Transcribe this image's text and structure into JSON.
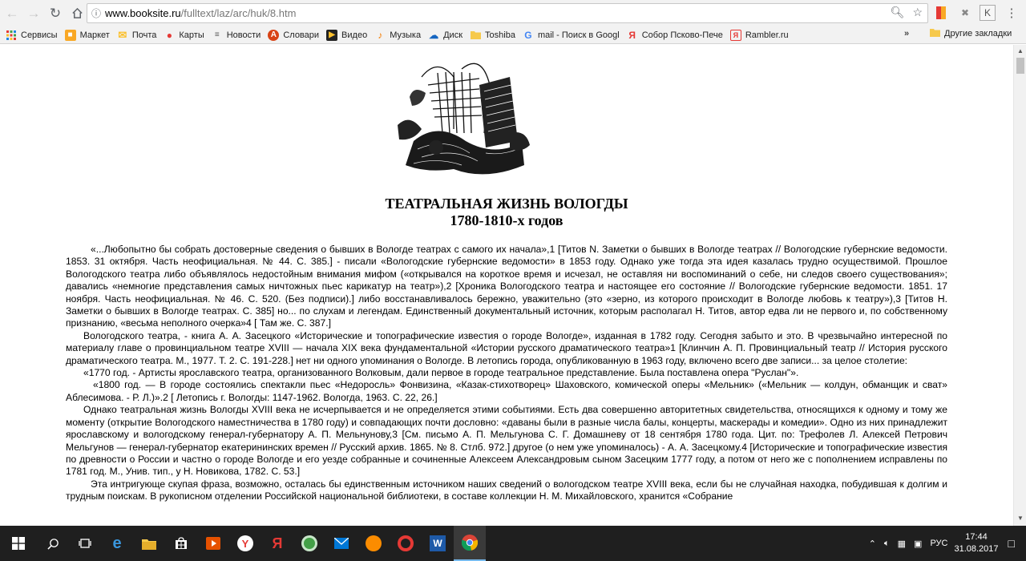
{
  "browser": {
    "url_host": "www.booksite.ru",
    "url_path": "/fulltext/laz/arc/huk/8.htm"
  },
  "bookmarks": {
    "items": [
      {
        "label": "Сервисы",
        "icon": "apps-grid-icon",
        "color": "#e53935"
      },
      {
        "label": "Маркет",
        "icon": "market-icon",
        "color": "#f9a825"
      },
      {
        "label": "Почта",
        "icon": "mail-icon",
        "color": "#fbc02d"
      },
      {
        "label": "Карты",
        "icon": "map-pin-icon",
        "color": "#e53935"
      },
      {
        "label": "Новости",
        "icon": "news-icon",
        "color": "#555555"
      },
      {
        "label": "Словари",
        "icon": "dictionary-icon",
        "color": "#d84315"
      },
      {
        "label": "Видео",
        "icon": "video-icon",
        "color": "#222222"
      },
      {
        "label": "Музыка",
        "icon": "music-icon",
        "color": "#f57c00"
      },
      {
        "label": "Диск",
        "icon": "disk-icon",
        "color": "#1565c0"
      },
      {
        "label": "Toshiba",
        "icon": "folder-icon",
        "color": "#f6c94c"
      },
      {
        "label": "mail - Поиск в Googl",
        "icon": "google-icon",
        "color": "#4285f4"
      },
      {
        "label": "Собор Псково-Пече",
        "icon": "yandex-icon",
        "color": "#e53935"
      },
      {
        "label": "Rambler.ru",
        "icon": "rambler-icon",
        "color": "#e53935"
      }
    ],
    "more": "»",
    "other": "Другие закладки"
  },
  "article": {
    "title_line1": "ТЕАТРАЛЬНАЯ ЖИЗНЬ ВОЛОГДЫ",
    "title_line2": "1780-1810-х годов",
    "paragraphs": [
      "«...Любопытно бы собрать достоверные сведения о бывших в Вологде театрах с самого их начала»,1 [Титов N. Заметки о бывших в Вологде театрах // Вологодские губернские ведомости. 1853. 31 октября. Часть неофициальная. № 44. С. 385.] - писали «Вологодские губернские ведомости» в 1853 году. Однако уже тогда эта идея казалась трудно осуществимой. Прошлое Вологодского театра либо объявлялось недостойным внимания мифом («открывался на короткое время и исчезал, не оставляя ни воспоминаний о себе, ни следов своего существования»; давались «немногие представления самых ничтожных пьес карикатур на театр»),2 [Хроника Вологодского театра и настоящее его состояние // Вологодские губернские ведомости. 1851. 17 ноября. Часть неофициальная. № 46. С. 520. (Без подписи).] либо восстанавливалось бережно, уважительно (это «зерно, из которого происходит в Вологде любовь к театру»),3 [Титов Н. Заметки о бывших в Вологде театрах. С. 385] но... по слухам и легендам. Единственный документальный источник, которым располагал Н. Титов, автор едва ли не первого и, по собственному признанию, «весьма неполного очерка»4 [ Там же. С. 387.]",
      "Вологодского театра, - книга А. А. Засецкого «Исторические и топографические известия о городе Вологде», изданная в 1782 году. Сегодня забыто и это. В чрезвычайно интересной по материалу главе о провинциальном театре XVIII — начала XIX века фундаментальной «Истории русского драматического театра»1 [Клинчин А. П. Провинциальный театр // История русского драматического театра. М., 1977. Т. 2. С. 191-228.] нет ни одного упоминания о Вологде. В летопись города, опубликованную в 1963 году, включено всего две записи... за целое столетие:",
      "«1770 год. - Артисты ярославского театра, организованного Волковым, дали первое в городе театральное представление. Была поставлена опера \"Руслан\"».",
      "«1800 год. — В городе состоялись спектакли пьес «Недоросль» Фонвизина, «Казак-стихотворец» Шаховского, комической оперы «Мельник» («Мельник — колдун, обманщик и сват» Аблесимова. - Р. Л.)».2 [ Летопись г. Вологды: 1147-1962. Вологда, 1963. С. 22, 26.]",
      "Однако театральная жизнь Вологды XVIII века не исчерпывается и не определяется этими событиями. Есть два совершенно авторитетных свидетельства, относящихся к одному и тому же моменту (открытие Вологодского наместничества в 1780 году) и совпадающих почти дословно: «даваны были в разные числа балы, концерты, маскерады и комедии». Одно из них принадлежит ярославскому и вологодскому генерал-губернатору А. П. Мельнунову,3 [См. письмо А. П. Мельгунова С. Г. Домашневу от 18 сентября 1780 года. Цит. по: Трефолев Л. Алексей Петрович Мельгунов — генерал-губернатор екатерининских времен // Русский архив. 1865. № 8. Стлб. 972.] другое (о нем уже упоминалось) - А. А. Засецкому.4 [Исторические и топографические известия по древности о России и частно о городе Вологде и его уезде собранные и сочиненные Алексеем Александровым сыном Засецким 1777 году, а потом от него же с пополнением исправлены по 1781 год. М., Унив. тип., у Н. Новикова, 1782. С. 53.]",
      "Эта интригующе скупая фраза, возможно, осталась бы единственным источником наших сведений о вологодском театре XVIII века, если бы не случайная находка, побудившая к долгим и трудным поискам. В рукописном отделении Российской национальной библиотеки, в составе коллекции Н. М. Михайловского, хранится «Собрание"
    ]
  },
  "taskbar": {
    "lang": "РУС",
    "time": "17:44",
    "date": "31.08.2017"
  }
}
